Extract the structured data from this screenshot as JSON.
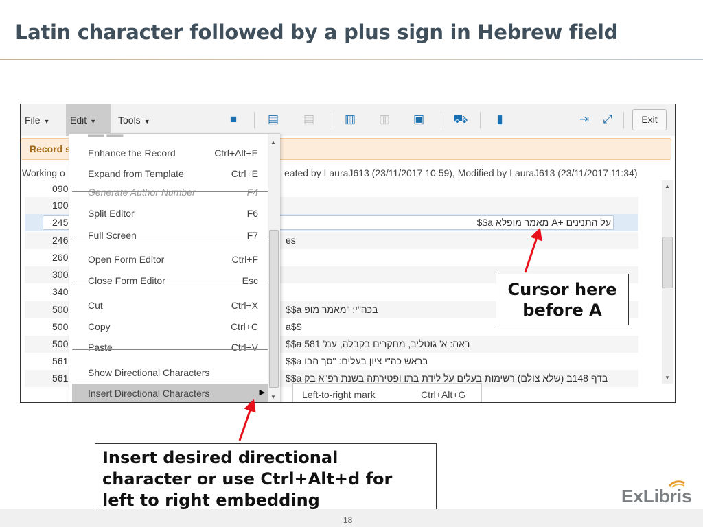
{
  "slide": {
    "title": "Latin character followed by a plus sign in Hebrew field",
    "page_number": "18",
    "logo_text": "ExLibris"
  },
  "toolbar": {
    "file": "File",
    "edit": "Edit",
    "tools": "Tools",
    "exit": "Exit",
    "icons": [
      "save-icon",
      "search-record-icon",
      "search-record-disabled-icon",
      "add-record-icon",
      "add-record-disabled-icon",
      "add-to-portfolio-icon",
      "cart-icon",
      "trash-icon",
      "split-panel-icon",
      "fullscreen-icon"
    ],
    "accent": "#1a6fb0"
  },
  "banner": {
    "text": "Record s"
  },
  "working": {
    "left": "Working o",
    "right": "eated by LauraJ613 (23/11/2017 10:59), Modified by LauraJ613 (23/11/2017 11:34)"
  },
  "rows": [
    {
      "tag": "090",
      "value": ""
    },
    {
      "tag": "100",
      "value": ""
    },
    {
      "tag": "245",
      "value": "$$a מאמר מופלא A+ על התנינים"
    },
    {
      "tag": "246",
      "value": "es"
    },
    {
      "tag": "260",
      "value": ""
    },
    {
      "tag": "300",
      "value": ""
    },
    {
      "tag": "340",
      "value": ""
    },
    {
      "tag": "500",
      "value": "$$a בכה\"י: \"מאמר מופ"
    },
    {
      "tag": "500",
      "value": "a$$"
    },
    {
      "tag": "500",
      "value": "$$a ראה: א' גוטליב, מחקרים בקבלה, עמ' 581"
    },
    {
      "tag": "561",
      "value": "$$a בראש כה\"י ציון בעלים: \"סך הבו"
    },
    {
      "tag": "561",
      "value": "$$a בדף 148ב (שלא צולם) רשימות בעלים על לידת בתו ופטירתה בשנת רפ\"א בק"
    }
  ],
  "edit_menu": {
    "items": [
      {
        "label": "Enhance the Record",
        "shortcut": "Ctrl+Alt+E"
      },
      {
        "label": "Expand from Template",
        "shortcut": "Ctrl+E"
      },
      {
        "label": "Generate Author Number",
        "shortcut": "F4"
      },
      {
        "label": "Split Editor",
        "shortcut": "F6"
      },
      {
        "label": "Full Screen",
        "shortcut": "F7"
      },
      {
        "label": "Open Form Editor",
        "shortcut": "Ctrl+F"
      },
      {
        "label": "Close Form Editor",
        "shortcut": "Esc"
      },
      {
        "label": "Cut",
        "shortcut": "Ctrl+X"
      },
      {
        "label": "Copy",
        "shortcut": "Ctrl+C"
      },
      {
        "label": "Paste",
        "shortcut": "Ctrl+V"
      },
      {
        "label": "Show Directional Characters",
        "shortcut": ""
      },
      {
        "label": "Insert Directional Characters",
        "shortcut": ""
      }
    ]
  },
  "submenu": {
    "label": "Left-to-right mark",
    "shortcut": "Ctrl+Alt+G"
  },
  "callouts": {
    "cursor": "Cursor here before A",
    "instruction": "Insert desired directional character or use Ctrl+Alt+d for left to right embedding",
    "arrow_color": "#e8101a"
  }
}
